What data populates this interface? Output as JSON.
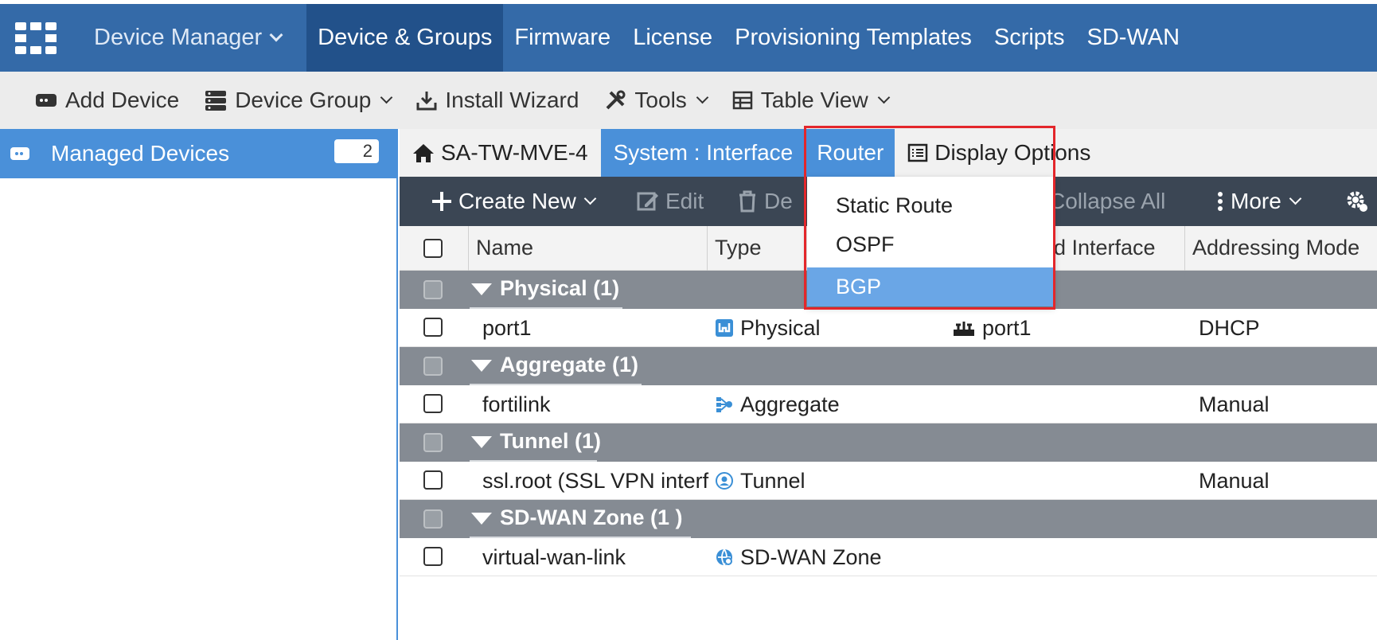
{
  "topnav": {
    "logo_icon": "fortinet-logo-icon",
    "device_manager": "Device Manager",
    "items": [
      "Device & Groups",
      "Firmware",
      "License",
      "Provisioning Templates",
      "Scripts",
      "SD-WAN"
    ],
    "active_index": 0
  },
  "toolbar": {
    "add_device": "Add Device",
    "device_group": "Device Group",
    "install_wizard": "Install Wizard",
    "tools": "Tools",
    "table_view": "Table View"
  },
  "sidebar": {
    "managed_devices": "Managed Devices",
    "count": "2"
  },
  "tabs": {
    "device": "SA-TW-MVE-4",
    "system_interface": "System : Interface",
    "router": "Router",
    "display_options": "Display Options"
  },
  "gridbar": {
    "create_new": "Create New",
    "edit": "Edit",
    "delete_partial": "De",
    "collapse_all": "Collapse All",
    "more": "More"
  },
  "table": {
    "columns": [
      "Name",
      "Type",
      "d Interface",
      "Addressing Mode"
    ],
    "groups": [
      {
        "label": "Physical (1)",
        "rows": [
          {
            "name": "port1",
            "type": "Physical",
            "interface": "port1",
            "mode": "DHCP"
          }
        ]
      },
      {
        "label": "Aggregate (1)",
        "rows": [
          {
            "name": "fortilink",
            "type": "Aggregate",
            "interface": "",
            "mode": "Manual"
          }
        ]
      },
      {
        "label": "Tunnel (1)",
        "rows": [
          {
            "name": "ssl.root (SSL VPN interf",
            "type": "Tunnel",
            "interface": "",
            "mode": "Manual"
          }
        ]
      },
      {
        "label": "SD-WAN Zone (1 )",
        "rows": [
          {
            "name": "virtual-wan-link",
            "type": "SD-WAN Zone",
            "interface": "",
            "mode": ""
          }
        ]
      }
    ]
  },
  "router_menu": {
    "items": [
      "Static Route",
      "OSPF",
      "BGP"
    ],
    "selected": "BGP"
  },
  "colors": {
    "nav_bg": "#346aa8",
    "nav_active": "#22518a",
    "accent_blue": "#4a90d9",
    "grid_toolbar": "#3b4654",
    "group_row": "#858b93",
    "highlight": "#e3262b"
  }
}
